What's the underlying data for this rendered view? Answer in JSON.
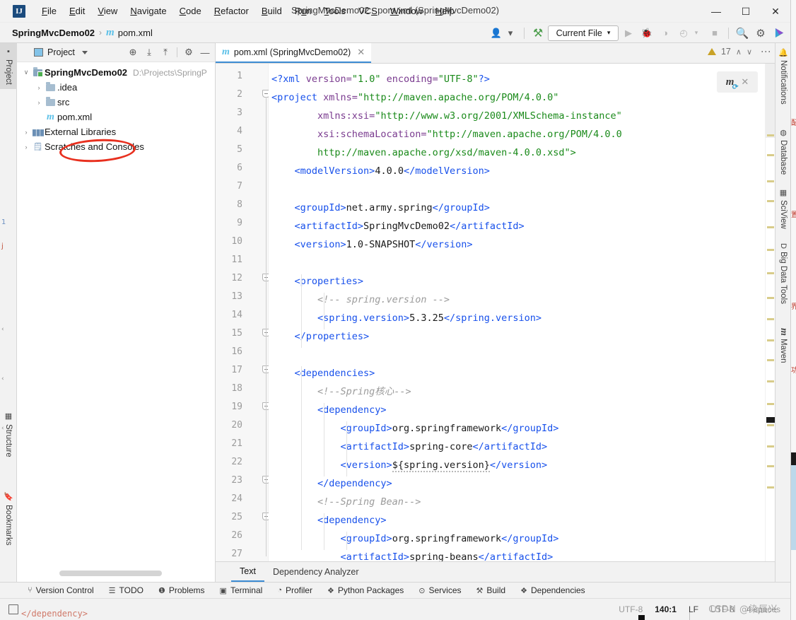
{
  "window": {
    "title": "SpringMvcDemo02 - pom.xml (SpringMvcDemo02)",
    "logo": "IJ",
    "minimize": "—",
    "maximize": "☐",
    "close": "✕"
  },
  "menubar": [
    {
      "label": "File"
    },
    {
      "label": "Edit"
    },
    {
      "label": "View"
    },
    {
      "label": "Navigate"
    },
    {
      "label": "Code"
    },
    {
      "label": "Refactor"
    },
    {
      "label": "Build"
    },
    {
      "label": "Run"
    },
    {
      "label": "Tools"
    },
    {
      "label": "VCS"
    },
    {
      "label": "Window"
    },
    {
      "label": "Help"
    }
  ],
  "navbar": {
    "project": "SpringMvcDemo02",
    "separator": "›",
    "maven_glyph": "m",
    "file": "pom.xml",
    "run_config": "Current File",
    "run_config_caret": "▾",
    "icons": {
      "user": "👤",
      "user_caret": "▾",
      "hammer": "⚒",
      "run": "▶",
      "debug": "🐞",
      "coverage": "◑",
      "profile": "◴",
      "profile_caret": "▾",
      "stop": "■",
      "search": "🔍",
      "settings": "⚙"
    }
  },
  "left_strip": [
    {
      "label": "Project",
      "icon": "project-icon",
      "active": true
    },
    {
      "label": "Structure",
      "icon": "structure-icon",
      "active": false
    },
    {
      "label": "Bookmarks",
      "icon": "bookmarks-icon",
      "active": false
    }
  ],
  "right_strip": [
    {
      "label": "Notifications",
      "icon": "bell-icon"
    },
    {
      "label": "Database",
      "icon": "database-icon"
    },
    {
      "label": "SciView",
      "icon": "sciview-icon"
    },
    {
      "label": "Big Data Tools",
      "icon": "bigdata-icon"
    },
    {
      "label": "Maven",
      "icon": "maven-icon"
    }
  ],
  "project_panel": {
    "title": "Project",
    "caret": "▾",
    "toolbar_icons": [
      "locate-icon",
      "expand-all-icon",
      "collapse-all-icon",
      "gear-icon",
      "hide-icon"
    ],
    "tree": [
      {
        "arrow": "∨",
        "label": "SpringMvcDemo02",
        "path": "D:\\Projects\\SpringP",
        "icon": "module-folder-icon",
        "bold": true,
        "depth": 0
      },
      {
        "arrow": "›",
        "label": ".idea",
        "icon": "folder-icon",
        "bold": false,
        "depth": 1
      },
      {
        "arrow": "›",
        "label": "src",
        "icon": "folder-icon",
        "bold": false,
        "depth": 1
      },
      {
        "arrow": "",
        "label": "pom.xml",
        "icon": "maven-file-icon",
        "bold": false,
        "depth": 1
      },
      {
        "arrow": "›",
        "label": "External Libraries",
        "icon": "libraries-icon",
        "bold": false,
        "depth": 0
      },
      {
        "arrow": "›",
        "label": "Scratches and Consoles",
        "icon": "scratches-icon",
        "bold": false,
        "depth": 0
      }
    ]
  },
  "editor": {
    "tab": {
      "glyph": "m",
      "label": "pom.xml (SpringMvcDemo02)",
      "close": "✕"
    },
    "kebab": "⋮",
    "inspection": {
      "warning_count": "17",
      "warning_icon": "warning-triangle-icon",
      "up": "∧",
      "down": "∨"
    },
    "maven_popup": {
      "glyph": "m",
      "refresh": "⟳",
      "close": "✕"
    },
    "bottom_tabs": [
      {
        "label": "Text",
        "active": true
      },
      {
        "label": "Dependency Analyzer",
        "active": false
      }
    ],
    "first_line": 1,
    "last_line": 27,
    "lines": [
      {
        "n": 1,
        "fold": false,
        "segs": [
          {
            "t": "<?",
            "c": "pi"
          },
          {
            "t": "xml",
            "c": "tg"
          },
          {
            "t": " version=",
            "c": "at"
          },
          {
            "t": "\"1.0\"",
            "c": "st"
          },
          {
            "t": " encoding=",
            "c": "at"
          },
          {
            "t": "\"UTF-8\"",
            "c": "st"
          },
          {
            "t": "?>",
            "c": "pi"
          }
        ]
      },
      {
        "n": 2,
        "fold": true,
        "segs": [
          {
            "t": "<project",
            "c": "tg"
          },
          {
            "t": " xmlns=",
            "c": "at"
          },
          {
            "t": "\"http://maven.apache.org/POM/4.0.0\"",
            "c": "st"
          }
        ]
      },
      {
        "n": 3,
        "fold": false,
        "segs": [
          {
            "t": "        xmlns:xsi=",
            "c": "at"
          },
          {
            "t": "\"http://www.w3.org/2001/XMLSchema-instance\"",
            "c": "st"
          }
        ]
      },
      {
        "n": 4,
        "fold": false,
        "segs": [
          {
            "t": "        xsi:schemaLocation=",
            "c": "at"
          },
          {
            "t": "\"http://maven.apache.org/POM/4.0.0",
            "c": "st"
          }
        ]
      },
      {
        "n": 5,
        "fold": false,
        "segs": [
          {
            "t": "        http://maven.apache.org/xsd/maven-4.0.0.xsd\">",
            "c": "st"
          }
        ]
      },
      {
        "n": 6,
        "fold": false,
        "segs": [
          {
            "t": "    <modelVersion>",
            "c": "tg"
          },
          {
            "t": "4.0.0",
            "c": "tx"
          },
          {
            "t": "</modelVersion>",
            "c": "tg"
          }
        ]
      },
      {
        "n": 7,
        "fold": false,
        "segs": []
      },
      {
        "n": 8,
        "fold": false,
        "segs": [
          {
            "t": "    <groupId>",
            "c": "tg"
          },
          {
            "t": "net.army.spring",
            "c": "tx"
          },
          {
            "t": "</groupId>",
            "c": "tg"
          }
        ]
      },
      {
        "n": 9,
        "fold": false,
        "segs": [
          {
            "t": "    <artifactId>",
            "c": "tg"
          },
          {
            "t": "SpringMvcDemo02",
            "c": "tx"
          },
          {
            "t": "</artifactId>",
            "c": "tg"
          }
        ]
      },
      {
        "n": 10,
        "fold": false,
        "segs": [
          {
            "t": "    <version>",
            "c": "tg"
          },
          {
            "t": "1.0-SNAPSHOT",
            "c": "tx"
          },
          {
            "t": "</version>",
            "c": "tg"
          }
        ]
      },
      {
        "n": 11,
        "fold": false,
        "segs": []
      },
      {
        "n": 12,
        "fold": true,
        "segs": [
          {
            "t": "    <properties>",
            "c": "tg"
          }
        ]
      },
      {
        "n": 13,
        "fold": false,
        "segs": [
          {
            "t": "        <!-- spring.version -->",
            "c": "cm"
          }
        ]
      },
      {
        "n": 14,
        "fold": false,
        "segs": [
          {
            "t": "        <spring.version>",
            "c": "tg"
          },
          {
            "t": "5.3.25",
            "c": "tx"
          },
          {
            "t": "</spring.version>",
            "c": "tg"
          }
        ]
      },
      {
        "n": 15,
        "fold": true,
        "segs": [
          {
            "t": "    </properties>",
            "c": "tg"
          }
        ]
      },
      {
        "n": 16,
        "fold": false,
        "segs": []
      },
      {
        "n": 17,
        "fold": true,
        "segs": [
          {
            "t": "    <dependencies>",
            "c": "tg"
          }
        ]
      },
      {
        "n": 18,
        "fold": false,
        "segs": [
          {
            "t": "        <!--Spring核心-->",
            "c": "cm"
          }
        ]
      },
      {
        "n": 19,
        "fold": true,
        "segs": [
          {
            "t": "        <dependency>",
            "c": "tg"
          }
        ]
      },
      {
        "n": 20,
        "fold": false,
        "segs": [
          {
            "t": "            <groupId>",
            "c": "tg"
          },
          {
            "t": "org.springframework",
            "c": "tx"
          },
          {
            "t": "</groupId>",
            "c": "tg"
          }
        ]
      },
      {
        "n": 21,
        "fold": false,
        "segs": [
          {
            "t": "            <artifactId>",
            "c": "tg"
          },
          {
            "t": "spring-core",
            "c": "tx"
          },
          {
            "t": "</artifactId>",
            "c": "tg"
          }
        ]
      },
      {
        "n": 22,
        "fold": false,
        "segs": [
          {
            "t": "            <version>",
            "c": "tg"
          },
          {
            "t": "${spring.version}",
            "c": "tx squig"
          },
          {
            "t": "</version>",
            "c": "tg"
          }
        ]
      },
      {
        "n": 23,
        "fold": true,
        "segs": [
          {
            "t": "        </dependency>",
            "c": "tg"
          }
        ]
      },
      {
        "n": 24,
        "fold": false,
        "segs": [
          {
            "t": "        <!--Spring Bean-->",
            "c": "cm"
          }
        ]
      },
      {
        "n": 25,
        "fold": true,
        "segs": [
          {
            "t": "        <dependency>",
            "c": "tg"
          }
        ]
      },
      {
        "n": 26,
        "fold": false,
        "segs": [
          {
            "t": "            <groupId>",
            "c": "tg"
          },
          {
            "t": "org.springframework",
            "c": "tx"
          },
          {
            "t": "</groupId>",
            "c": "tg"
          }
        ]
      },
      {
        "n": 27,
        "fold": false,
        "segs": [
          {
            "t": "            <artifactId>",
            "c": "tg"
          },
          {
            "t": "spring-beans",
            "c": "tx"
          },
          {
            "t": "</artifactId>",
            "c": "tg"
          }
        ]
      }
    ]
  },
  "bottom_bar": [
    {
      "label": "Version Control",
      "icon": "branch-icon"
    },
    {
      "label": "TODO",
      "icon": "list-icon"
    },
    {
      "label": "Problems",
      "icon": "problems-icon"
    },
    {
      "label": "Terminal",
      "icon": "terminal-icon"
    },
    {
      "label": "Profiler",
      "icon": "profiler-icon"
    },
    {
      "label": "Python Packages",
      "icon": "packages-icon"
    },
    {
      "label": "Services",
      "icon": "services-icon"
    },
    {
      "label": "Build",
      "icon": "build-icon"
    },
    {
      "label": "Dependencies",
      "icon": "dependencies-icon"
    }
  ],
  "status_bar": {
    "left_icon": "layout-icon",
    "encoding_left": "UTF-8",
    "caret_position": "140:1",
    "line_separator": "LF",
    "file_encoding": "UTF-8",
    "indent": "4 spaces",
    "watermark": "CSDN @染辰兴"
  },
  "colors": {
    "accent": "#3c8cd4",
    "tag": "#1750eb",
    "attribute": "#7a3b8f",
    "string": "#1a8a1a",
    "comment": "#9b9b9b",
    "annotation_red": "#e8301f",
    "warning": "#c9a227",
    "maven_blue": "#5bc0e8"
  }
}
